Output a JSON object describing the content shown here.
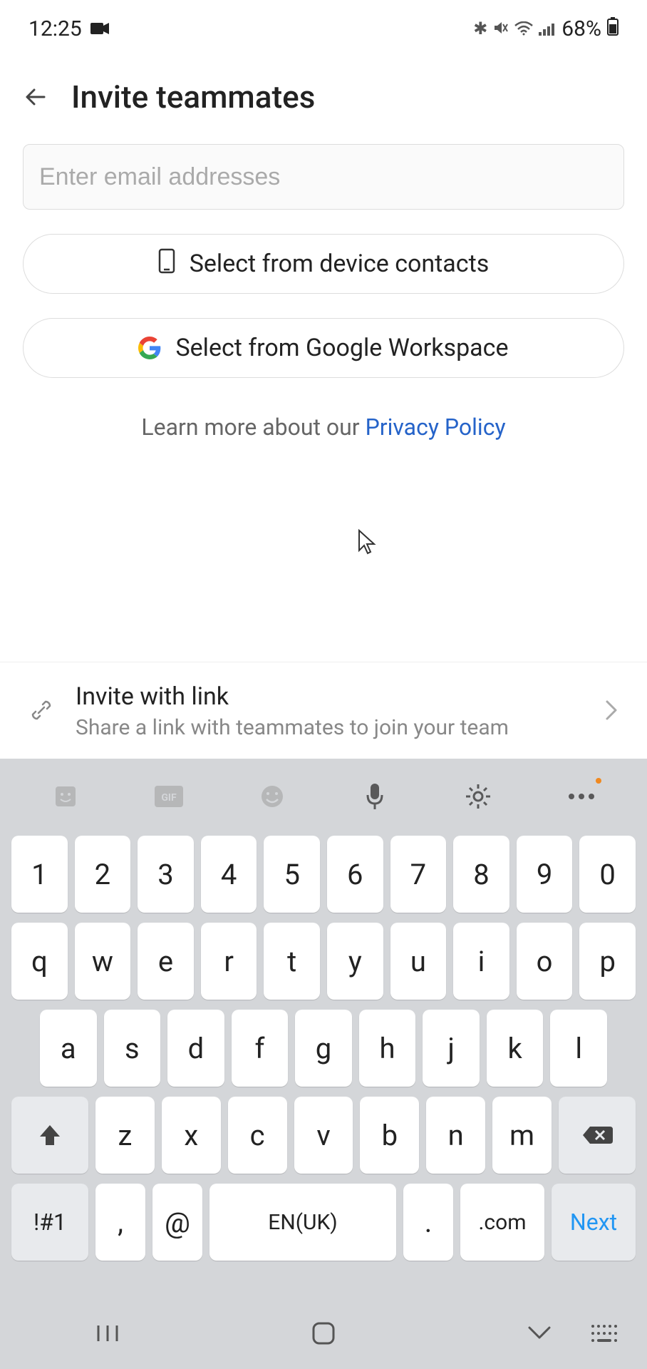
{
  "status": {
    "time": "12:25",
    "battery": "68%"
  },
  "header": {
    "title": "Invite teammates"
  },
  "email": {
    "placeholder": "Enter email addresses",
    "value": ""
  },
  "buttons": {
    "contacts": "Select from device contacts",
    "google": "Select from Google Workspace"
  },
  "privacy": {
    "prefix": "Learn more about our ",
    "link": "Privacy Policy"
  },
  "inviteLink": {
    "title": "Invite with link",
    "subtitle": "Share a link with teammates to join your team"
  },
  "keyboard": {
    "row1": [
      "1",
      "2",
      "3",
      "4",
      "5",
      "6",
      "7",
      "8",
      "9",
      "0"
    ],
    "row2": [
      "q",
      "w",
      "e",
      "r",
      "t",
      "y",
      "u",
      "i",
      "o",
      "p"
    ],
    "row3": [
      "a",
      "s",
      "d",
      "f",
      "g",
      "h",
      "j",
      "k",
      "l"
    ],
    "row4": [
      "z",
      "x",
      "c",
      "v",
      "b",
      "n",
      "m"
    ],
    "sym": "!#1",
    "comma": ",",
    "at": "@",
    "space": "EN(UK)",
    "dot": ".",
    "com": ".com",
    "next": "Next"
  }
}
